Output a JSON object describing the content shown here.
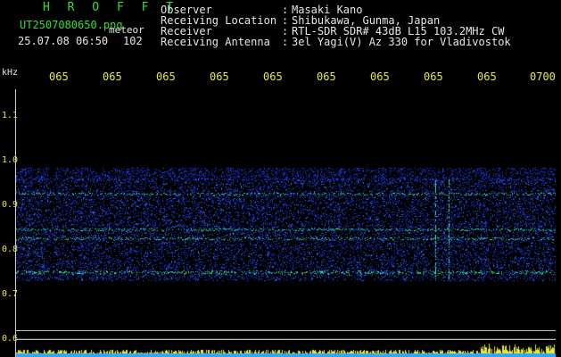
{
  "header": {
    "title": "H R O F F T",
    "filename": "UT2507080650.png",
    "meteor_label": "meteor",
    "date_time": "25.07.08 06:50",
    "count": "102"
  },
  "info": [
    {
      "label": "Observer",
      "value": "Masaki Kano"
    },
    {
      "label": "Receiving Location",
      "value": "Shibukawa, Gunma, Japan"
    },
    {
      "label": "Receiver",
      "value": "RTL-SDR SDR# 43dB L15 103.2MHz CW"
    },
    {
      "label": "Receiving Antenna",
      "value": "3el Yagi(V) Az 330 for Vladivostok"
    }
  ],
  "info_colon": ":",
  "axis": {
    "unit": "kHz",
    "y_labels": [
      "1.1",
      "1.0",
      "0.9",
      "0.8",
      "0.7",
      "0.6"
    ],
    "y_values": [
      1.1,
      1.0,
      0.9,
      0.8,
      0.7,
      0.6
    ],
    "x_labels": [
      "065",
      "065",
      "065",
      "065",
      "065",
      "065",
      "065",
      "065",
      "065",
      "0700"
    ],
    "y_range": [
      0.6,
      1.2
    ]
  },
  "spectrogram": {
    "band_range_khz": [
      0.77,
      1.0
    ],
    "lines_khz": [
      0.79,
      0.865,
      0.885,
      0.965
    ]
  },
  "colors": {
    "header_green": "#33dd33",
    "text_white": "#e6e6e6",
    "axis_yellow": "#e8e84a",
    "noise_blue": "#1c3cf0",
    "signal_cyan": "#35e0e0",
    "signal_green": "#40e040",
    "peak_red": "#ff3020"
  }
}
